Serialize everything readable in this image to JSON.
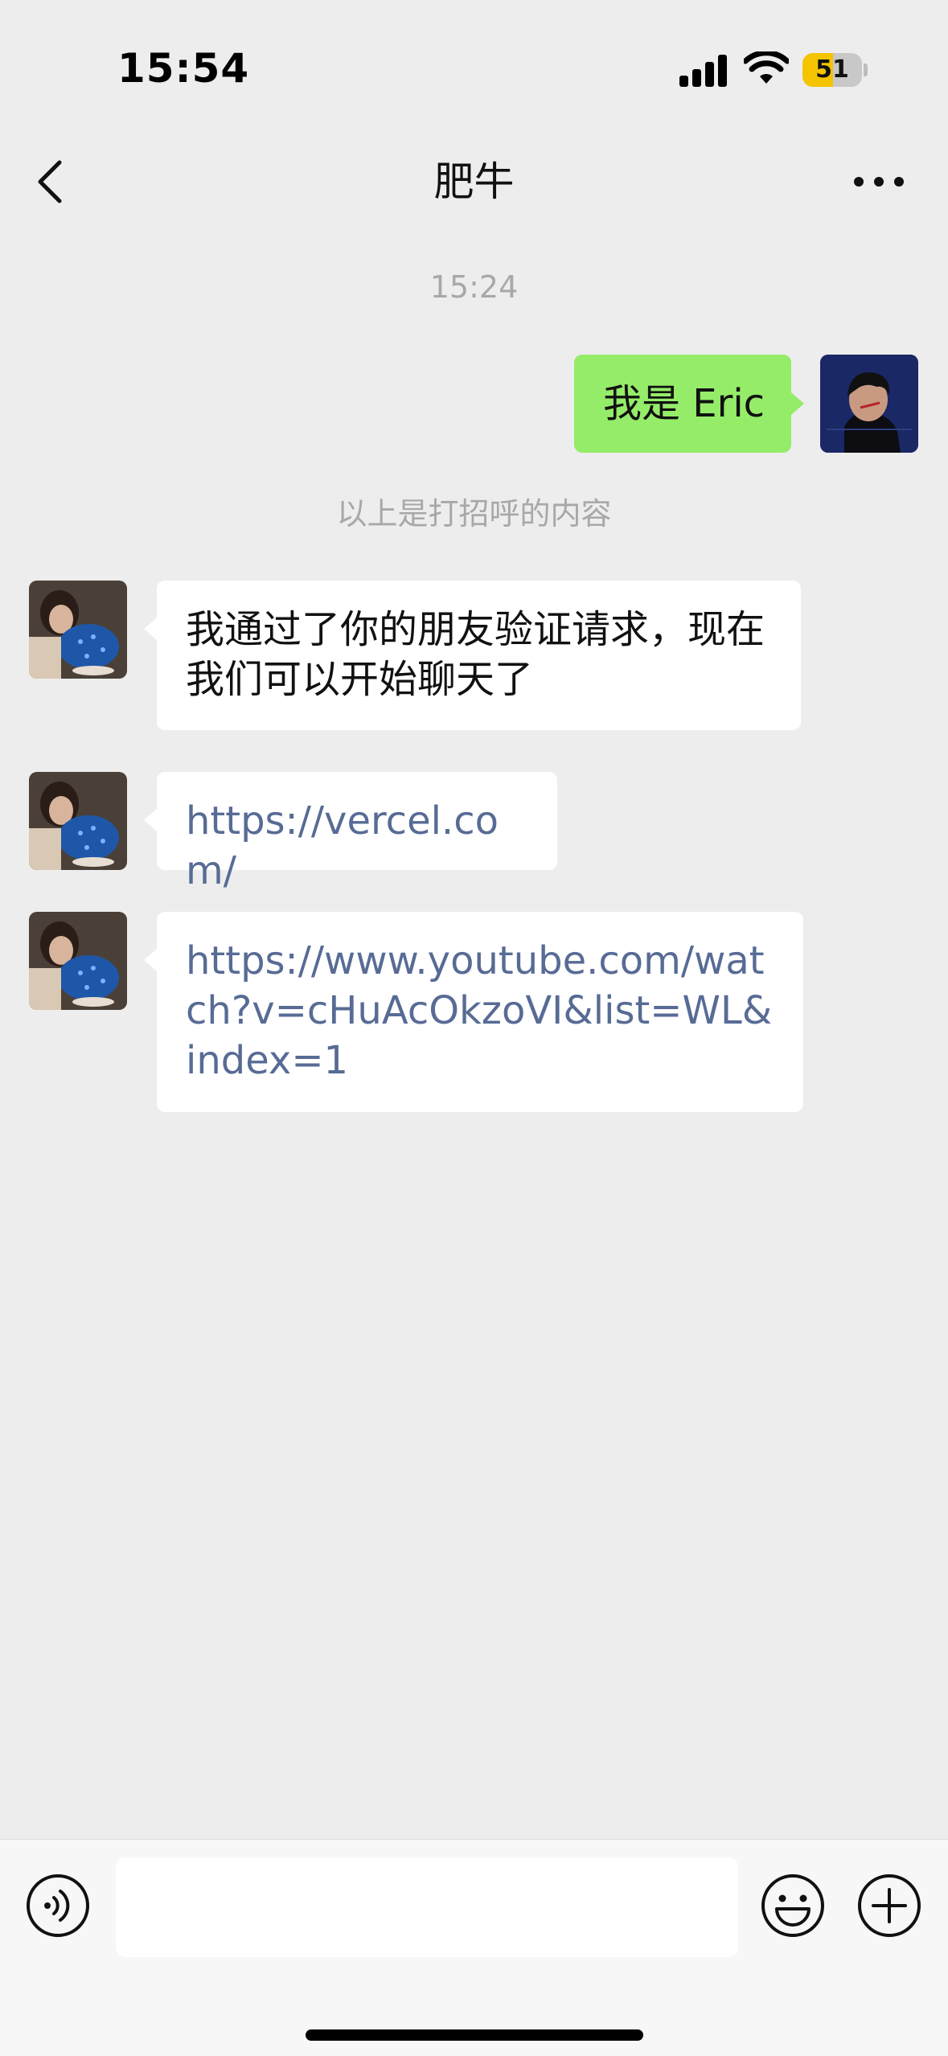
{
  "status_bar": {
    "time": "15:54",
    "battery_level": "51",
    "battery_fraction": 0.51,
    "icons": [
      "signal-icon",
      "wifi-icon",
      "battery-icon"
    ]
  },
  "nav": {
    "title": "肥牛",
    "back_icon": "chevron-left-icon",
    "more_icon": "more-dots-icon"
  },
  "chat": {
    "timestamp": "15:24",
    "sent_greeting": "我是 Eric",
    "greeting_hint": "以上是打招呼的内容",
    "received": [
      {
        "text": "我通过了你的朋友验证请求，现在我们可以开始聊天了",
        "is_link": false
      },
      {
        "text": "https://vercel.com/",
        "is_link": true
      },
      {
        "text": "https://www.youtube.com/watch?v=cHuAcOkzoVI&list=WL&index=1",
        "is_link": true
      }
    ]
  },
  "input_bar": {
    "voice_icon": "voice-icon",
    "emoji_icon": "emoji-icon",
    "plus_icon": "plus-icon",
    "input_value": ""
  },
  "colors": {
    "background": "#ededed",
    "sent_bubble": "#95ec69",
    "received_bubble": "#ffffff",
    "link": "#576b95",
    "battery_fill": "#f5c400"
  }
}
